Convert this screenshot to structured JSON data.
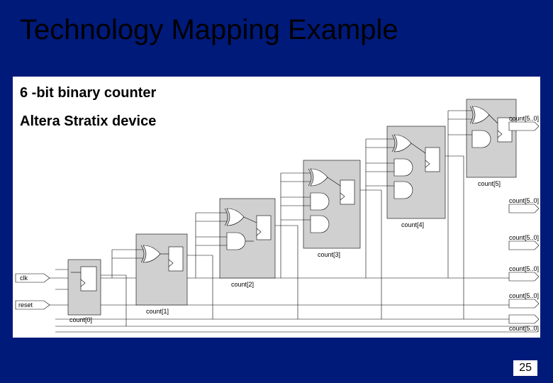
{
  "slide": {
    "title": "Technology Mapping Example",
    "subtitle1": "6 -bit binary counter",
    "subtitle2": "Altera Stratix device",
    "page_number": "25"
  },
  "inputs": [
    {
      "name": "clk"
    },
    {
      "name": "reset"
    }
  ],
  "cells": [
    {
      "name": "count[0]",
      "label": "count[0]"
    },
    {
      "name": "count[1]",
      "label": "count[1]"
    },
    {
      "name": "count[2]",
      "label": "count[2]"
    },
    {
      "name": "count[3]",
      "label": "count[3]"
    },
    {
      "name": "count[4]",
      "label": "count[4]"
    },
    {
      "name": "count[5]",
      "label": "count[5]"
    }
  ],
  "outputs": [
    {
      "name": "count[5..0]",
      "label": "count[5..0]"
    },
    {
      "name": "count[5..0]",
      "label": "count[5..0]"
    },
    {
      "name": "count[5..0]",
      "label": "count[5..0]"
    },
    {
      "name": "count[5..0]",
      "label": "count[5..0]"
    },
    {
      "name": "count[5..0]",
      "label": "count[5..0]"
    },
    {
      "name": "count[5..0]",
      "label": "count[5..0]"
    }
  ]
}
